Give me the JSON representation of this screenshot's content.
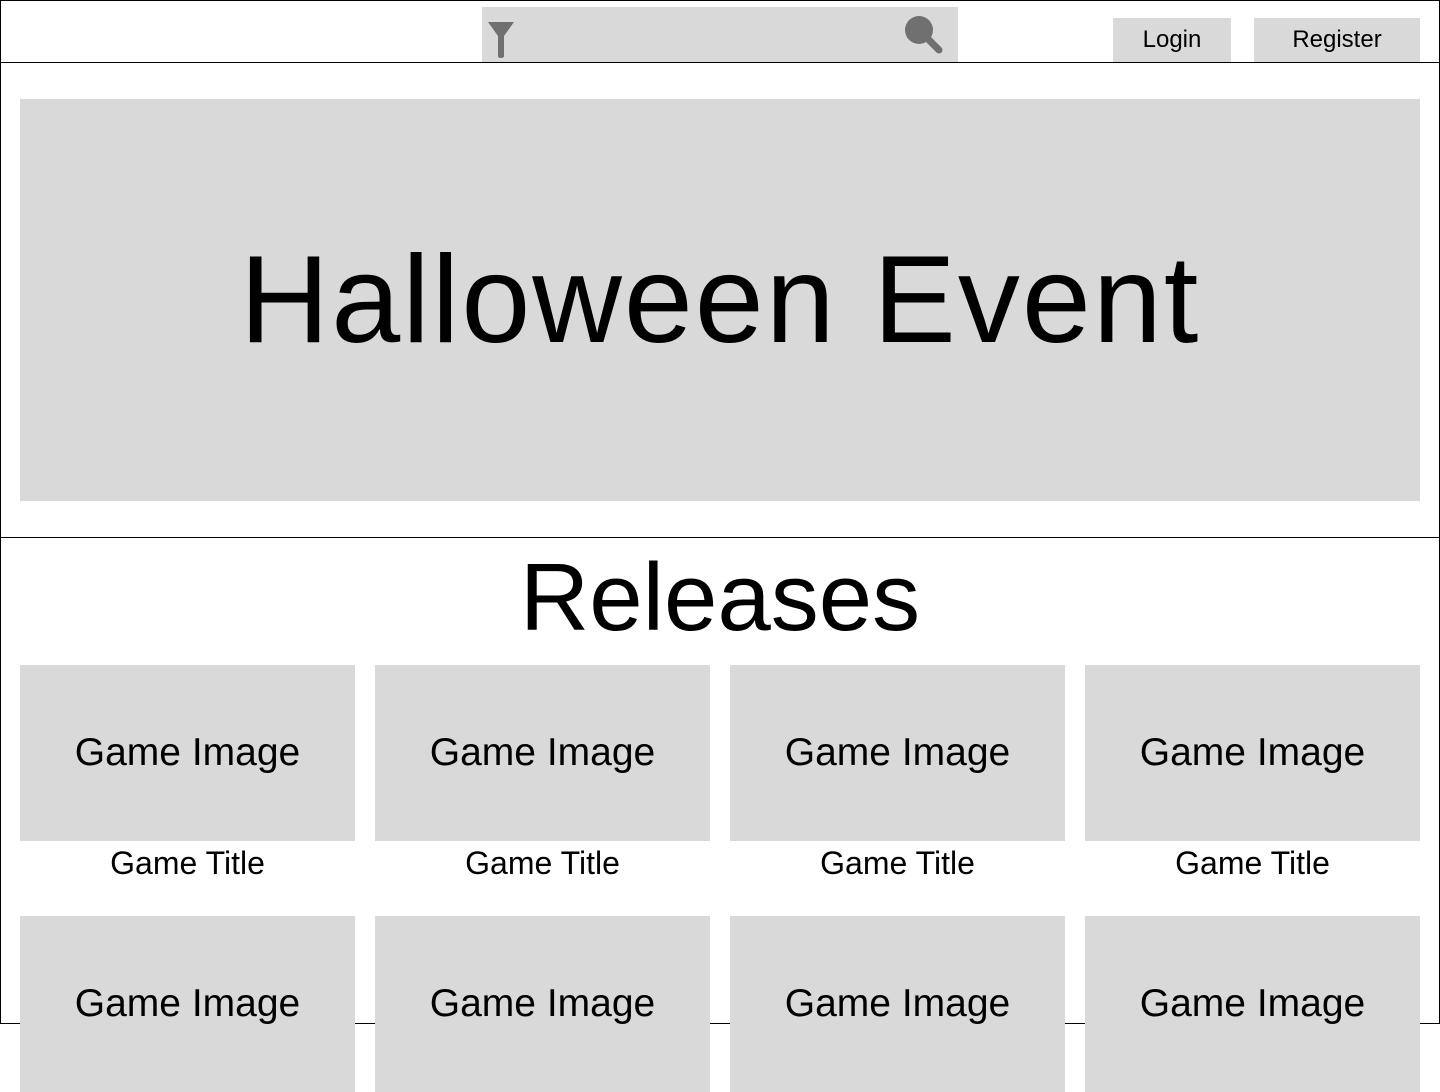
{
  "header": {
    "search_placeholder": "",
    "login_label": "Login",
    "register_label": "Register"
  },
  "hero": {
    "title": "Halloween Event"
  },
  "releases": {
    "title": "Releases",
    "games": [
      {
        "image_label": "Game Image",
        "title": "Game Title"
      },
      {
        "image_label": "Game Image",
        "title": "Game Title"
      },
      {
        "image_label": "Game Image",
        "title": "Game Title"
      },
      {
        "image_label": "Game Image",
        "title": "Game Title"
      },
      {
        "image_label": "Game Image",
        "title": ""
      },
      {
        "image_label": "Game Image",
        "title": ""
      },
      {
        "image_label": "Game Image",
        "title": ""
      },
      {
        "image_label": "Game Image",
        "title": ""
      }
    ]
  },
  "colors": {
    "placeholder_gray": "#d9d9d9",
    "icon_gray": "#707070",
    "border": "#000000"
  },
  "icons": {
    "filter": "filter-icon",
    "search": "search-icon"
  }
}
